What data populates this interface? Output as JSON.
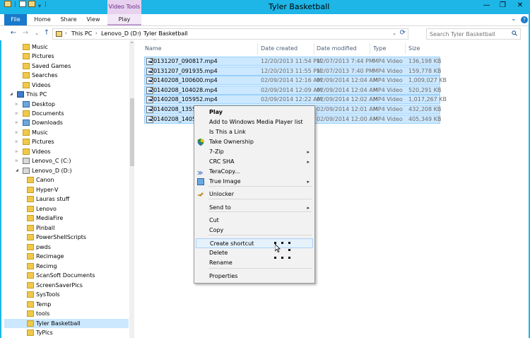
{
  "window": {
    "title": "Tyler Basketball",
    "contextual_tab_group": "Video Tools",
    "minimize": "—",
    "maximize": "❐",
    "close": "✕"
  },
  "ribbon": {
    "tabs": [
      "File",
      "Home",
      "Share",
      "View",
      "Play"
    ],
    "collapse": "⌄",
    "help": "?"
  },
  "nav": {
    "back": "←",
    "forward": "→",
    "recent": "⌄",
    "up": "↑",
    "refresh": "⟳"
  },
  "address": {
    "crumbs": [
      "This PC",
      "Lenovo_D (D:)",
      "Tyler Basketball"
    ],
    "separator": "›"
  },
  "search": {
    "placeholder": "Search Tyler Basketball"
  },
  "tree": [
    {
      "label": "Music",
      "kind": "folder-yellow"
    },
    {
      "label": "Pictures",
      "kind": "folder-yellow"
    },
    {
      "label": "Saved Games",
      "kind": "folder-yellow"
    },
    {
      "label": "Searches",
      "kind": "folder-yellow"
    },
    {
      "label": "Videos",
      "kind": "folder-yellow"
    },
    {
      "label": "This PC",
      "kind": "pc"
    },
    {
      "label": "Desktop",
      "kind": "folder-blue"
    },
    {
      "label": "Documents",
      "kind": "folder-yellow"
    },
    {
      "label": "Downloads",
      "kind": "folder-blue"
    },
    {
      "label": "Music",
      "kind": "folder-yellow"
    },
    {
      "label": "Pictures",
      "kind": "folder-yellow"
    },
    {
      "label": "Videos",
      "kind": "folder-yellow"
    },
    {
      "label": "Lenovo_C (C:)",
      "kind": "drive"
    },
    {
      "label": "Lenovo_D (D:)",
      "kind": "drive"
    },
    {
      "label": "Canon",
      "kind": "folder-yellow"
    },
    {
      "label": "Hyper-V",
      "kind": "folder-yellow"
    },
    {
      "label": "Lauras stuff",
      "kind": "folder-yellow"
    },
    {
      "label": "Lenovo",
      "kind": "folder-yellow"
    },
    {
      "label": "MediaFire",
      "kind": "folder-yellow"
    },
    {
      "label": "Pinball",
      "kind": "folder-yellow"
    },
    {
      "label": "PowerShellScripts",
      "kind": "folder-yellow"
    },
    {
      "label": "pwds",
      "kind": "folder-yellow"
    },
    {
      "label": "Recimage",
      "kind": "folder-yellow"
    },
    {
      "label": "Recimg",
      "kind": "folder-yellow"
    },
    {
      "label": "ScanSoft Documents",
      "kind": "folder-yellow"
    },
    {
      "label": "ScreenSaverPics",
      "kind": "folder-yellow"
    },
    {
      "label": "SysTools",
      "kind": "folder-yellow"
    },
    {
      "label": "Temp",
      "kind": "folder-yellow"
    },
    {
      "label": "tools",
      "kind": "folder-yellow"
    },
    {
      "label": "Tyler Basketball",
      "kind": "folder-yellow"
    },
    {
      "label": "TyPics",
      "kind": "folder-yellow"
    }
  ],
  "columns": [
    "Name",
    "Date created",
    "Date modified",
    "Type",
    "Size"
  ],
  "sort_indicator": "^",
  "files": [
    {
      "name": "20131207_090817.mp4",
      "created": "12/20/2013 11:54 PM",
      "modified": "12/07/2013 7:44 PM",
      "type": "MP4 Video",
      "size": "136,198 KB"
    },
    {
      "name": "20131207_091935.mp4",
      "created": "12/20/2013 11:55 PM",
      "modified": "12/07/2013 7:40 PM",
      "type": "MP4 Video",
      "size": "159,778 KB"
    },
    {
      "name": "20140208_100600.mp4",
      "created": "02/09/2014 12:16 AM",
      "modified": "02/09/2014 12:04 AM",
      "type": "MP4 Video",
      "size": "1,009,027 KB"
    },
    {
      "name": "20140208_104028.mp4",
      "created": "02/09/2014 12:09 AM",
      "modified": "02/09/2014 12:04 AM",
      "type": "MP4 Video",
      "size": "520,291 KB"
    },
    {
      "name": "20140208_105952.mp4",
      "created": "02/09/2014 12:22 AM",
      "modified": "02/09/2014 12:02 AM",
      "type": "MP4 Video",
      "size": "1,017,267 KB"
    },
    {
      "name": "20140208_13553",
      "created": "",
      "modified": "02/09/2014 12:01 AM",
      "type": "MP4 Video",
      "size": "432,208 KB"
    },
    {
      "name": "20140208_14052",
      "created": "",
      "modified": "02/09/2014 12:00 AM",
      "type": "MP4 Video",
      "size": "405,349 KB"
    }
  ],
  "context_menu": {
    "items": [
      {
        "label": "Play",
        "bold": true
      },
      {
        "label": "Add to Windows Media Player list"
      },
      {
        "label": "Is This a Link"
      },
      {
        "label": "Take Ownership",
        "icon": "shield"
      },
      {
        "label": "7-Zip",
        "submenu": true
      },
      {
        "label": "CRC SHA",
        "submenu": true
      },
      {
        "label": "TeraCopy...",
        "icon": "teracopy"
      },
      {
        "label": "True Image",
        "icon": "trueimage",
        "submenu": true
      },
      {
        "label": "Unlocker",
        "icon": "unlocker"
      },
      {
        "label": "Send to",
        "submenu": true
      },
      {
        "label": "Cut"
      },
      {
        "label": "Copy"
      },
      {
        "label": "Create shortcut",
        "hover": true
      },
      {
        "label": "Delete"
      },
      {
        "label": "Rename"
      },
      {
        "label": "Properties"
      }
    ],
    "submenu_arrow": "▸"
  },
  "colors": {
    "titlebar": "#1eb5e7",
    "selection": "#cce8ff",
    "file_tab": "#1979ca",
    "context_tab": "#e7d1ef"
  }
}
